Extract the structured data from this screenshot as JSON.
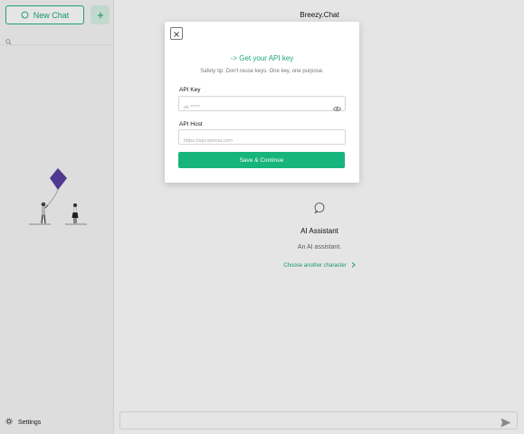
{
  "sidebar": {
    "new_chat_label": "New Chat",
    "settings_label": "Settings"
  },
  "main": {
    "title": "Breezy.Chat",
    "character": {
      "name": "AI Assistant",
      "description": "An AI assistant.",
      "choose_label": "Choose another character"
    }
  },
  "modal": {
    "link_text": "-> Get your API key",
    "tip": "Safety tip: Don't reuse keys. One key, one purpose.",
    "api_key_label": "API Key",
    "api_key_placeholder": "sk-*****",
    "api_host_label": "API Host",
    "api_host_placeholder": "https://api.openai.com",
    "save_label": "Save & Continue"
  },
  "colors": {
    "accent": "#1aa971",
    "button_bg": "#17b47d"
  },
  "icons": [
    "chat-bubble-icon",
    "plus-icon",
    "search-icon",
    "gear-icon",
    "close-icon",
    "eye-icon",
    "send-icon",
    "chevron-right-icon"
  ]
}
